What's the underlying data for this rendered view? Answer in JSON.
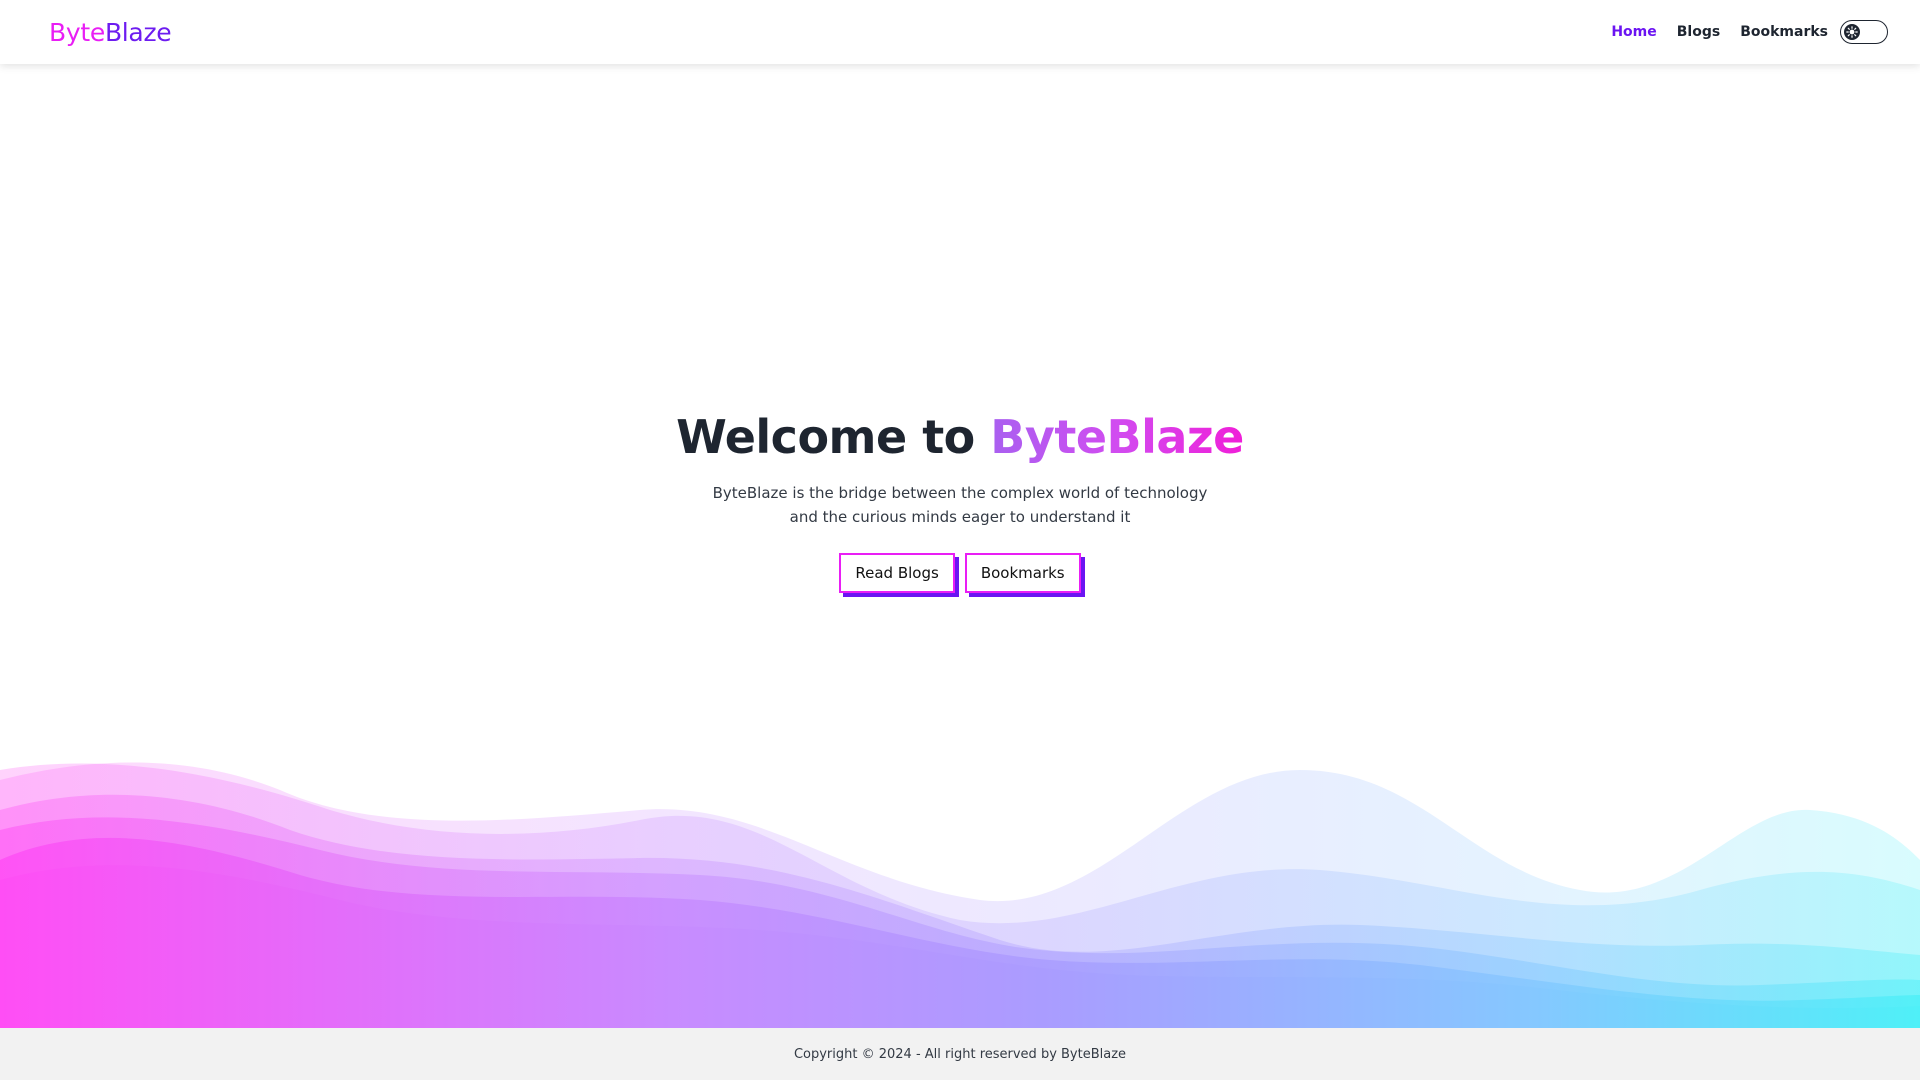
{
  "navbar": {
    "brand_part1": "Byte",
    "brand_part2": "Blaze",
    "links": [
      {
        "label": "Home"
      },
      {
        "label": "Blogs"
      },
      {
        "label": "Bookmarks"
      }
    ],
    "theme_toggle_icon": "gear-sun-icon"
  },
  "hero": {
    "title_prefix": "Welcome to ",
    "title_highlight": "ByteBlaze",
    "description": "ByteBlaze is the bridge between the complex world of technology and the curious minds eager to understand it",
    "buttons": {
      "read_blogs": "Read Blogs",
      "bookmarks": "Bookmarks"
    }
  },
  "footer": {
    "copyright": "Copyright © 2024 - All right reserved by ByteBlaze"
  },
  "colors": {
    "brand_pink": "#e91ef5",
    "brand_purple": "#6d1cf0",
    "active_link": "#6b14f2",
    "wave_left": "#ff4ef5",
    "wave_mid": "#a99dff",
    "wave_right": "#4ff0f8"
  }
}
